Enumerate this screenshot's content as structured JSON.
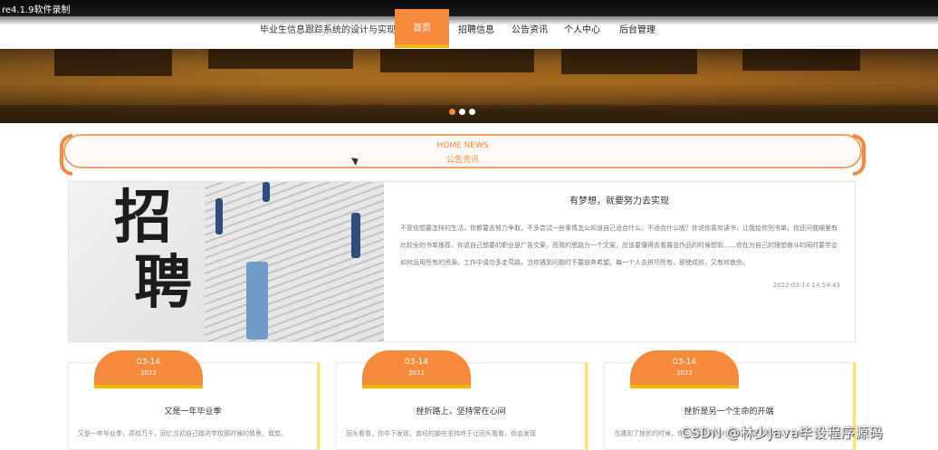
{
  "recorder_label": "re4.1.9软件录制",
  "header": {
    "site_title": "毕业生信息跟踪系统的设计与实现",
    "nav": [
      {
        "label": "首页",
        "active": true
      },
      {
        "label": "招聘信息",
        "active": false
      },
      {
        "label": "公告资讯",
        "active": false
      },
      {
        "label": "个人中心",
        "active": false
      },
      {
        "label": "后台管理",
        "active": false
      }
    ]
  },
  "carousel": {
    "slide_count": 3,
    "active_index": 0
  },
  "section": {
    "title_en": "HOME NEWS",
    "title_cn": "公告资讯"
  },
  "featured": {
    "image_text_1": "招",
    "image_text_2": "聘",
    "title": "有梦想，就要努力去实现",
    "body": "不管你想要怎样的生活，你都要去努力争取，不多尝试一些事情怎么知道自己适合什么、不适合什么呢？你说你喜欢读书，让我给你列书单，你还问我哪里有比较全的书单推荐，你说自己想要的职业是广告文案，而我的思路为一个文案，应该要懂得去看展览作品的时候想到……你在为自己的理想奋斗的同时要学会如何运用所有的资源。工作中请勿多走弯路，当你遇到问题时不要放弃希望。每一个人去拼尽所有，即使成败，又有何哀伤。",
    "date": "2022-03-14 14:54:43"
  },
  "cards": [
    {
      "date": "03-14",
      "year": "2022",
      "title": "又是一年毕业季",
      "text": "又是一年毕业季，高校万千，回忆当初自己踏进学校那时候的情景，我想，"
    },
    {
      "date": "03-14",
      "year": "2022",
      "title": "挫折路上，坚持常在心间",
      "text": "回头看看，你中下发现，曾经的那些坚持终于让回头看看，你会发现"
    },
    {
      "date": "03-14",
      "year": "2022",
      "title": "挫折是另一个生命的开端",
      "text": "当遇到了挫折的时候，你会感觉到无比的悲伤，但是当你度过了这段"
    }
  ],
  "watermark": "CSDN @林少Java毕设程序源码",
  "colors": {
    "accent": "#f58a3c",
    "accent_border": "#f7b500",
    "active_dot": "#f58a3c"
  }
}
